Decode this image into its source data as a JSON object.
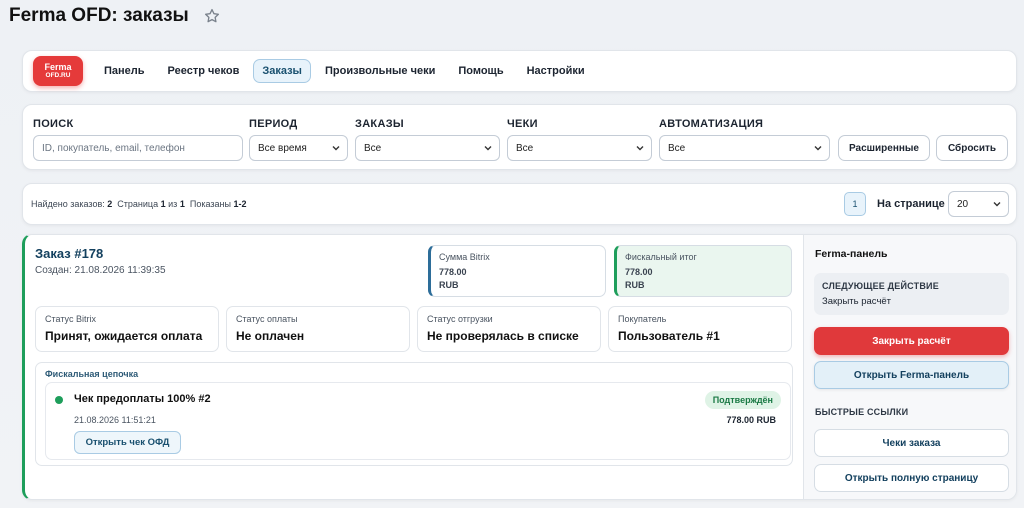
{
  "header": {
    "title": "Ferma OFD: заказы"
  },
  "logo": {
    "line1": "Ferma",
    "line2": "OFD.RU"
  },
  "nav": {
    "items": [
      {
        "label": "Панель"
      },
      {
        "label": "Реестр чеков"
      },
      {
        "label": "Заказы",
        "active": true
      },
      {
        "label": "Произвольные чеки"
      },
      {
        "label": "Помощь"
      },
      {
        "label": "Настройки"
      }
    ]
  },
  "filters": {
    "search": {
      "label": "ПОИСК",
      "placeholder": "ID, покупатель, email, телефон"
    },
    "period": {
      "label": "ПЕРИОД",
      "value": "Все время"
    },
    "orders": {
      "label": "ЗАКАЗЫ",
      "value": "Все"
    },
    "receipts": {
      "label": "ЧЕКИ",
      "value": "Все"
    },
    "automation": {
      "label": "АВТОМАТИЗАЦИЯ",
      "value": "Все"
    },
    "advanced_button": "Расширенные",
    "reset_button": "Сбросить"
  },
  "summary": {
    "found_label": "Найдено заказов:",
    "found_value": "2",
    "page_label": "Страница",
    "page_current": "1",
    "page_of": "из",
    "page_total": "1",
    "shown_label": "Показаны",
    "shown_range": "1-2",
    "current_page": "1",
    "per_page_label": "На странице",
    "per_page_value": "20"
  },
  "order": {
    "title": "Заказ #178",
    "created": "Создан: 21.08.2026 11:39:35",
    "bitrix_sum": {
      "caption": "Сумма Bitrix",
      "value": "778.00",
      "currency": "RUB"
    },
    "fiscal_total": {
      "caption": "Фискальный итог",
      "value": "778.00",
      "currency": "RUB"
    },
    "statuses": [
      {
        "caption": "Статус Bitrix",
        "value": "Принят, ожидается оплата"
      },
      {
        "caption": "Статус оплаты",
        "value": "Не оплачен"
      },
      {
        "caption": "Статус отгрузки",
        "value": "Не проверялась в списке"
      },
      {
        "caption": "Покупатель",
        "value": "Пользователь #1"
      }
    ],
    "chain": {
      "title": "Фискальная цепочка",
      "receipt": {
        "title": "Чек предоплаты 100% #2",
        "date": "21.08.2026 11:51:21",
        "badge": "Подтверждён",
        "sum": "778.00 RUB",
        "open_button": "Открыть чек ОФД"
      }
    }
  },
  "panel": {
    "title": "Ferma-панель",
    "next_action_caption": "СЛЕДУЮЩЕЕ ДЕЙСТВИЕ",
    "next_action_value": "Закрыть расчёт",
    "close_button": "Закрыть расчёт",
    "open_panel_button": "Открыть Ferma-панель",
    "quick_links_title": "БЫСТРЫЕ ССЫЛКИ",
    "order_receipts_button": "Чеки заказа",
    "full_page_button": "Открыть полную страницу"
  },
  "colors": {
    "accent": "#1e9e5b",
    "danger": "#e0393b",
    "brand": "#e53a3a",
    "link": "#13405e"
  }
}
